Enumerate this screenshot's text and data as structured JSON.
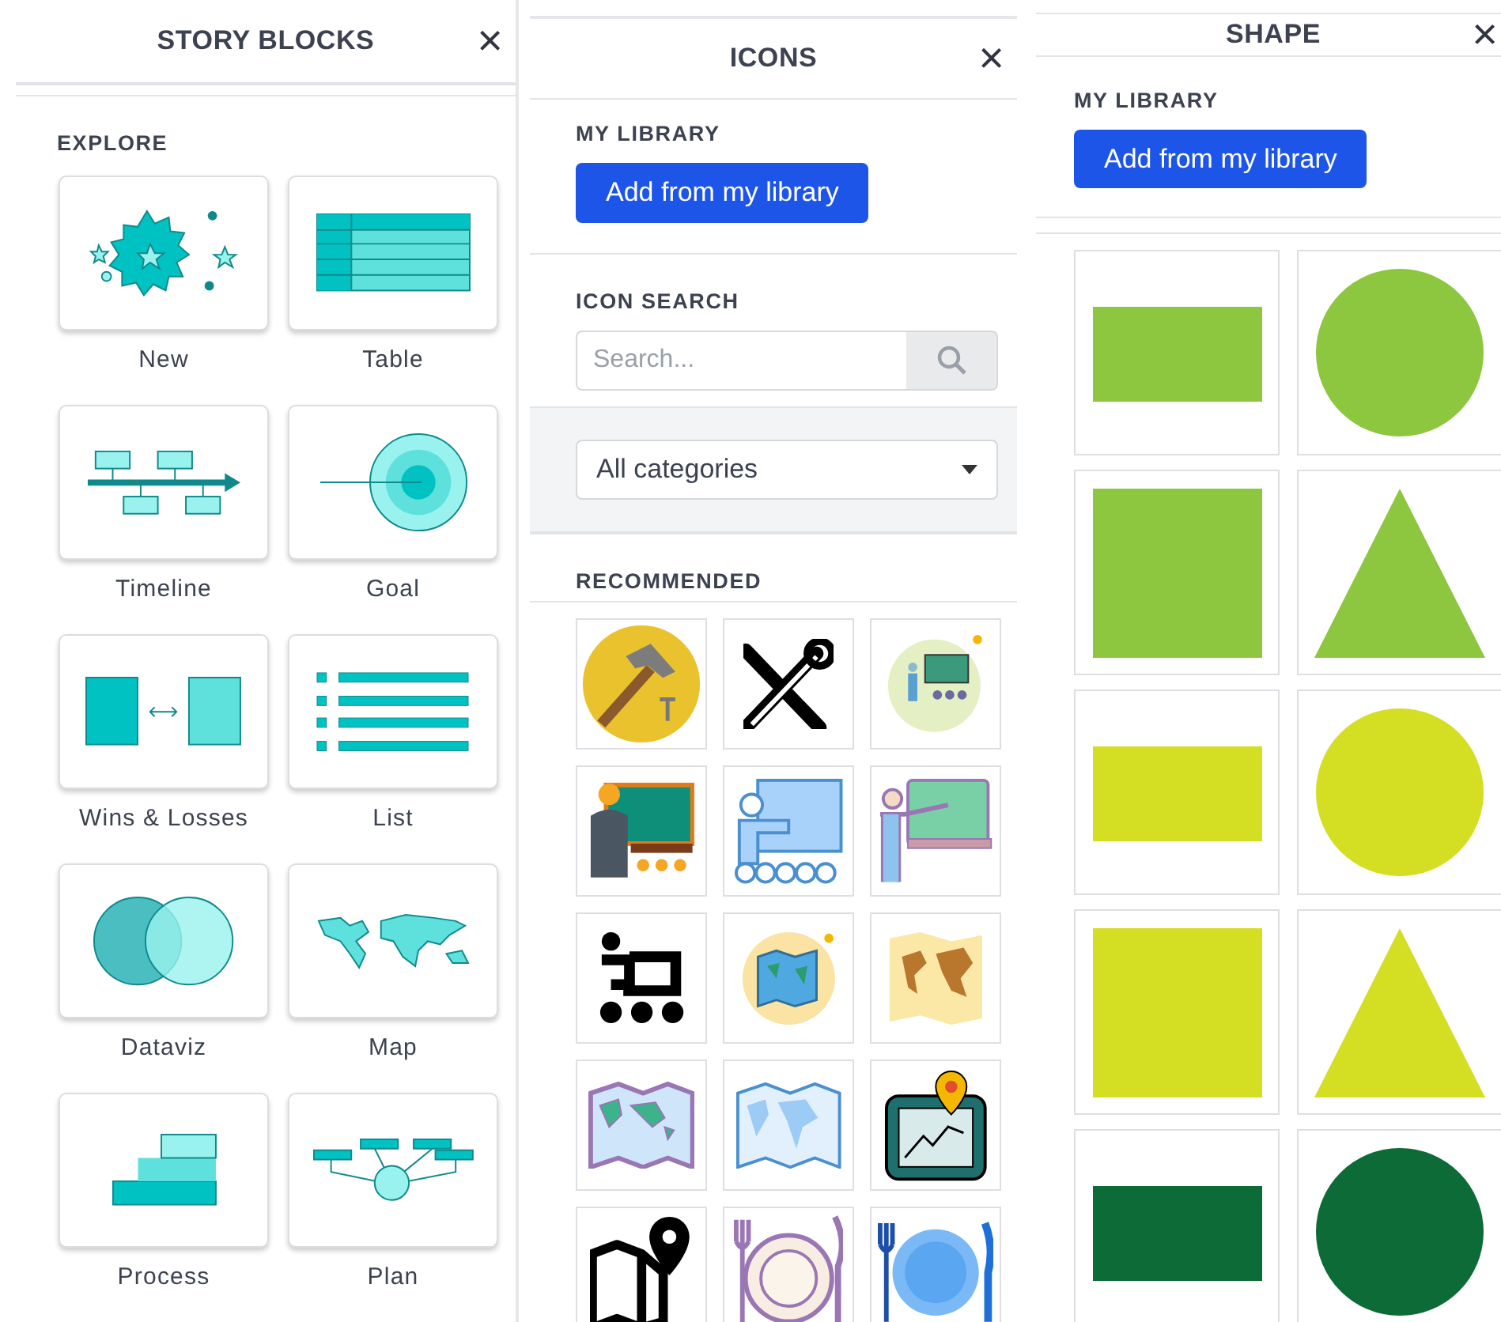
{
  "story_blocks_panel": {
    "title": "STORY BLOCKS",
    "close": "×",
    "section": "EXPLORE",
    "blocks": [
      {
        "label": "New",
        "kind": "new"
      },
      {
        "label": "Table",
        "kind": "table"
      },
      {
        "label": "Timeline",
        "kind": "timeline"
      },
      {
        "label": "Goal",
        "kind": "goal"
      },
      {
        "label": "Wins & Losses",
        "kind": "compare"
      },
      {
        "label": "List",
        "kind": "list"
      },
      {
        "label": "Dataviz",
        "kind": "dataviz"
      },
      {
        "label": "Map",
        "kind": "map"
      },
      {
        "label": "Process",
        "kind": "process"
      },
      {
        "label": "Plan",
        "kind": "plan"
      }
    ]
  },
  "icons_panel": {
    "title": "ICONS",
    "close": "×",
    "library_heading": "MY LIBRARY",
    "library_button": "Add from my library",
    "search_heading": "ICON SEARCH",
    "search": {
      "placeholder": "Search..."
    },
    "category_select": "All categories",
    "recommended_heading": "RECOMMENDED",
    "icons": [
      {
        "kind": "hammer"
      },
      {
        "kind": "tools"
      },
      {
        "kind": "teacher-circle"
      },
      {
        "kind": "teacher-board"
      },
      {
        "kind": "teacher-outline"
      },
      {
        "kind": "teacher-purple"
      },
      {
        "kind": "presenter-glyph"
      },
      {
        "kind": "map-circle"
      },
      {
        "kind": "map-tan"
      },
      {
        "kind": "map-purple"
      },
      {
        "kind": "map-blue"
      },
      {
        "kind": "map-pin-board"
      },
      {
        "kind": "map-pin-glyph"
      },
      {
        "kind": "plate-purple"
      },
      {
        "kind": "plate-blue"
      }
    ]
  },
  "shape_panel": {
    "title": "SHAPE",
    "close": "×",
    "library_heading": "MY LIBRARY",
    "library_button": "Add from my library",
    "shapes": [
      {
        "kind": "rectangle",
        "color": "#8dc63f"
      },
      {
        "kind": "circle",
        "color": "#8dc63f"
      },
      {
        "kind": "square",
        "color": "#8dc63f"
      },
      {
        "kind": "triangle",
        "color": "#8dc63f"
      },
      {
        "kind": "rectangle",
        "color": "#d4de23"
      },
      {
        "kind": "circle",
        "color": "#d4de23"
      },
      {
        "kind": "square",
        "color": "#d4de23"
      },
      {
        "kind": "triangle",
        "color": "#d4de23"
      },
      {
        "kind": "rectangle",
        "color": "#0d6b37"
      },
      {
        "kind": "circle",
        "color": "#0d6b37"
      }
    ]
  }
}
